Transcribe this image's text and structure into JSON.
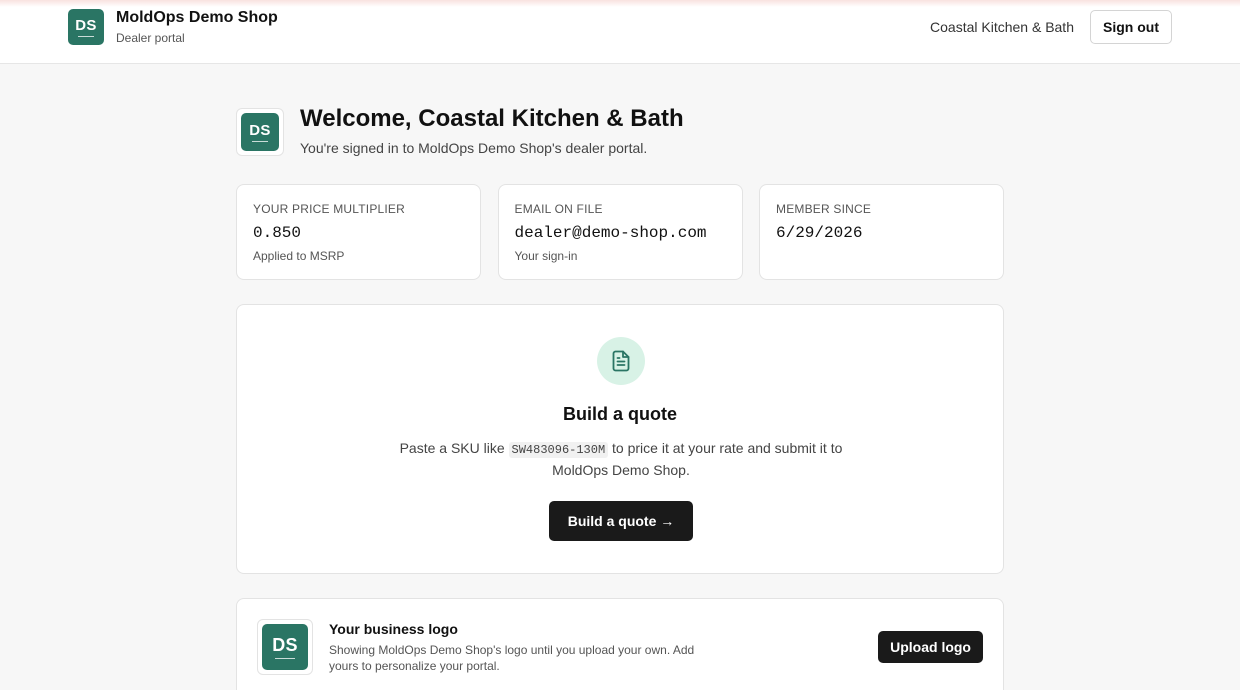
{
  "header": {
    "logo_initials": "DS",
    "shop_name": "MoldOps Demo Shop",
    "portal_label": "Dealer portal",
    "account_name": "Coastal Kitchen & Bath",
    "signout_label": "Sign out"
  },
  "welcome": {
    "logo_initials": "DS",
    "title": "Welcome, Coastal Kitchen & Bath",
    "subtitle": "You're signed in to MoldOps Demo Shop's dealer portal."
  },
  "stats": [
    {
      "label": "YOUR PRICE MULTIPLIER",
      "value": "0.850",
      "note": "Applied to MSRP"
    },
    {
      "label": "EMAIL ON FILE",
      "value": "dealer@demo-shop.com",
      "note": "Your sign-in"
    },
    {
      "label": "MEMBER SINCE",
      "value": "6/29/2026",
      "note": ""
    }
  ],
  "quote": {
    "icon": "document-icon",
    "title": "Build a quote",
    "desc_before": "Paste a SKU like ",
    "sku_example": "SW483096-130M",
    "desc_after": " to price it at your rate and submit it to MoldOps Demo Shop.",
    "button_label": "Build a quote →"
  },
  "logo_section": {
    "logo_initials": "DS",
    "title": "Your business logo",
    "description": "Showing MoldOps Demo Shop's logo until you upload your own. Add yours to personalize your portal.",
    "button_label": "Upload logo"
  },
  "colors": {
    "brand": "#2a7564",
    "icon_bg": "#d8f2e6",
    "button": "#1a1a1a"
  }
}
